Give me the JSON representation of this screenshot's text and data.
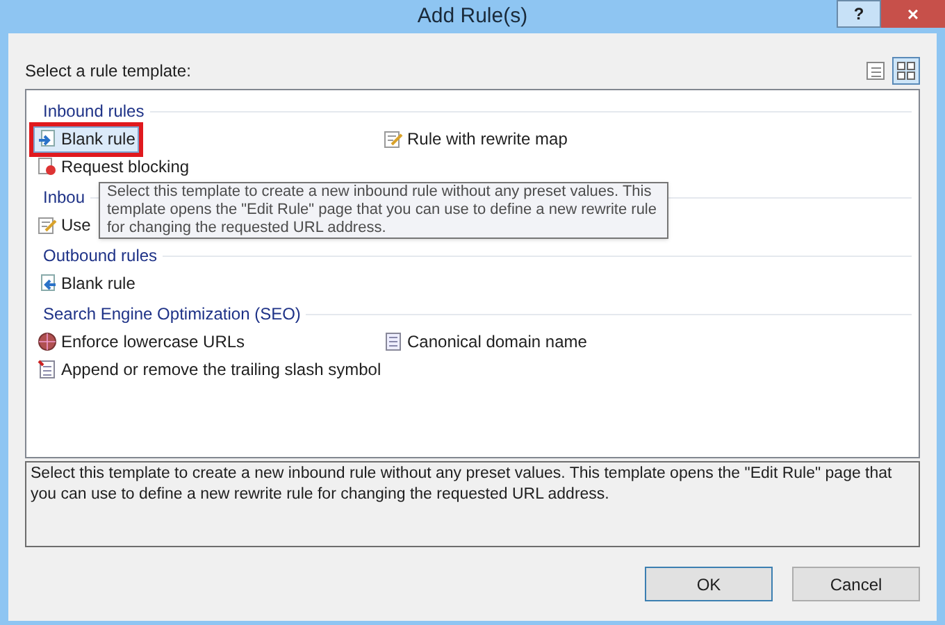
{
  "window": {
    "title": "Add Rule(s)",
    "buttons": [
      "?",
      "×"
    ]
  },
  "prompt": "Select a rule template:",
  "view_buttons": [
    {
      "kind": "details",
      "selected": false
    },
    {
      "kind": "tiles",
      "selected": true
    }
  ],
  "sections": [
    {
      "title": "Inbound rules",
      "items": [
        {
          "label": "Blank rule",
          "kind": "blank-in",
          "selected": true,
          "outlined": true
        },
        {
          "label": "Rule with rewrite map",
          "kind": "edit",
          "selected": false,
          "outlined": false
        },
        {
          "label": "Request blocking",
          "kind": "block",
          "selected": false,
          "outlined": false
        }
      ]
    },
    {
      "title": "Inbou",
      "items": [
        {
          "label": "Use",
          "kind": "edit",
          "selected": false,
          "outlined": false
        }
      ]
    },
    {
      "title": "Outbound rules",
      "items": [
        {
          "label": "Blank rule",
          "kind": "blank-out",
          "selected": false,
          "outlined": false
        }
      ]
    },
    {
      "title": "Search Engine Optimization (SEO)",
      "items": [
        {
          "label": "Enforce lowercase URLs",
          "kind": "globe",
          "selected": false,
          "outlined": false
        },
        {
          "label": "Canonical domain name",
          "kind": "doc",
          "selected": false,
          "outlined": false
        },
        {
          "label": "Append or remove the trailing slash symbol",
          "kind": "doc-red",
          "selected": false,
          "outlined": false
        }
      ]
    }
  ],
  "tooltip": "Select this template to create a new inbound rule without any preset values. This template opens the \"Edit Rule\" page that you can use to define a new rewrite rule for changing the requested URL address.",
  "description": "Select this template to create a new inbound rule without any preset values. This template opens the \"Edit Rule\" page that you can use to define a new rewrite rule for changing the requested URL address.",
  "actions": [
    "OK",
    "Cancel"
  ]
}
